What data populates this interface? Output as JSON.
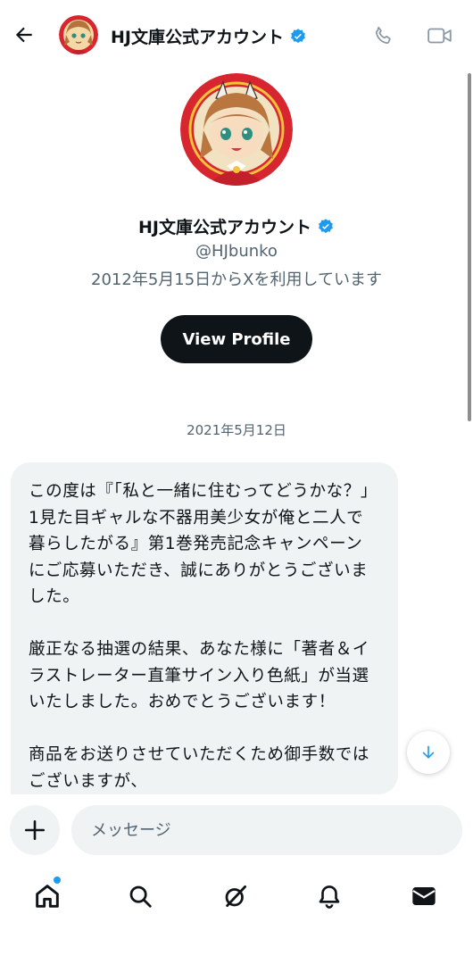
{
  "header": {
    "account_name": "HJ文庫公式アカウント",
    "icons": {
      "back": "arrow-left-icon",
      "verified": "verified-badge-icon",
      "call": "phone-icon",
      "video": "video-camera-icon"
    }
  },
  "profile": {
    "name": "HJ文庫公式アカウント",
    "handle": "@HJbunko",
    "joined": "2012年5月15日からXを利用しています",
    "view_profile_label": "View Profile"
  },
  "conversation": {
    "date_separator": "2021年5月12日",
    "message_text": "この度は『「私と一緒に住むってどうかな？」\n1見た目ギャルな不器用美少女が俺と二人で\n暮らしたがる』第1巻発売記念キャンペーン\nにご応募いただき、誠にありがとうございま\nした。\n\n厳正なる抽選の結果、あなた様に「著者＆イ\nラストレーター直筆サイン入り色紙」が当選\nいたしました。おめでとうございます！\n\n商品をお送りさせていただくため御手数では\nございますが、"
  },
  "composer": {
    "placeholder": "メッセージ",
    "add_icon": "plus-icon"
  },
  "bottom_nav": {
    "items": [
      "home-icon",
      "search-icon",
      "grok-icon",
      "notifications-bell-icon",
      "messages-envelope-icon"
    ]
  },
  "colors": {
    "accent": "#1d9bf0",
    "text": "#0f1419",
    "muted": "#536471",
    "bubble": "#eff3f4",
    "avatar_red": "#d7262f"
  }
}
